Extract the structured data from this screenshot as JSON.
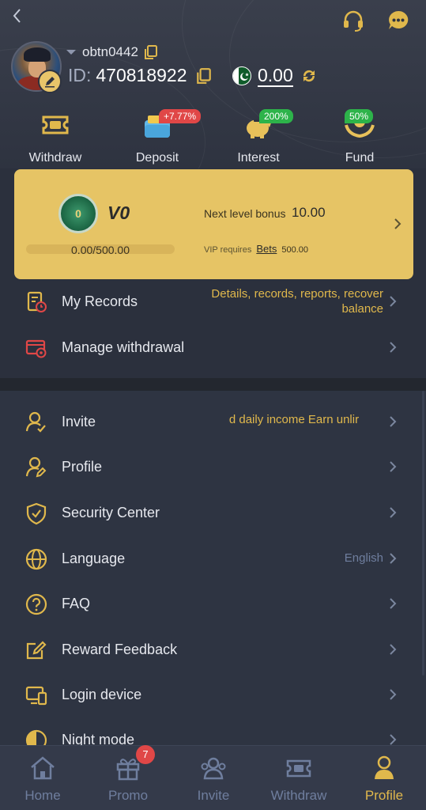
{
  "header": {
    "username": "obtn0442",
    "id_label": "ID:",
    "id_value": "470818922",
    "balance": "0.00"
  },
  "quick_actions": [
    {
      "label": "Withdraw",
      "icon": "withdraw-ticket-icon"
    },
    {
      "label": "Deposit",
      "icon": "deposit-wallet-icon",
      "badge": "+7.77%"
    },
    {
      "label": "Interest",
      "icon": "interest-piggy-icon",
      "badge": "200%"
    },
    {
      "label": "Fund",
      "icon": "fund-hands-icon",
      "badge": "50%"
    }
  ],
  "vip": {
    "level": "V0",
    "medal_text": "0",
    "progress_text": "0.00/500.00",
    "progress_fraction": 0.0,
    "next_level_label": "Next level bonus",
    "next_level_value": "10.00",
    "requires_label": "VIP requires",
    "requires_bets": "Bets",
    "requires_amount": "500.00"
  },
  "menu_top": [
    {
      "label": "My Records",
      "icon": "records-icon",
      "hint": "Details, records, reports, recover balance"
    },
    {
      "label": "Manage withdrawal",
      "icon": "manage-withdrawal-icon"
    }
  ],
  "menu_main": [
    {
      "label": "Invite",
      "icon": "invite-icon",
      "hint": "ited daily income  Earn unlir"
    },
    {
      "label": "Profile",
      "icon": "profile-icon"
    },
    {
      "label": "Security Center",
      "icon": "shield-icon"
    },
    {
      "label": "Language",
      "icon": "globe-icon",
      "hint": "English"
    },
    {
      "label": "FAQ",
      "icon": "question-icon"
    },
    {
      "label": "Reward Feedback",
      "icon": "feedback-edit-icon"
    },
    {
      "label": "Login device",
      "icon": "login-device-icon"
    },
    {
      "label": "Night mode",
      "icon": "night-mode-icon"
    }
  ],
  "tabs": [
    {
      "label": "Home",
      "icon": "home-icon",
      "active": false
    },
    {
      "label": "Promo",
      "icon": "gift-icon",
      "active": false,
      "badge": "7"
    },
    {
      "label": "Invite",
      "icon": "invite-people-icon",
      "active": false
    },
    {
      "label": "Withdraw",
      "icon": "withdraw-tab-icon",
      "active": false
    },
    {
      "label": "Profile",
      "icon": "profile-tab-icon",
      "active": true
    }
  ],
  "colors": {
    "accent": "#e0b84c",
    "vip_card": "#e6c465",
    "badge_red": "#e04747",
    "badge_green": "#2db34a",
    "background": "#2b303d",
    "muted": "#6f7e9e"
  }
}
